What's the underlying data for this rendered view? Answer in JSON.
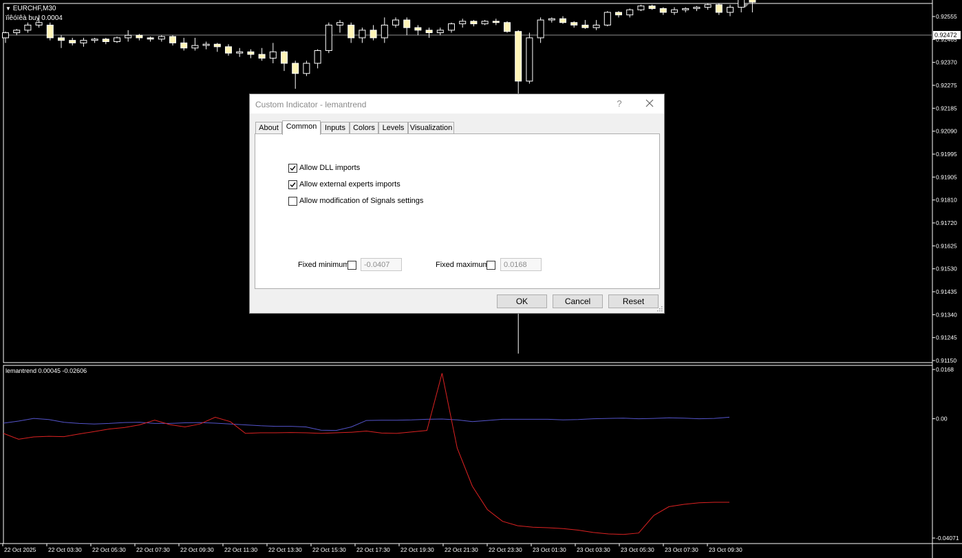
{
  "chart_header": {
    "symbol": "EURCHF,M30",
    "trade_label": "ïîêóïêà buy 0.0004"
  },
  "indicator_header": "lemantrend 0.00045 -0.02606",
  "colors": {
    "background": "#000000",
    "candle": "#FFFFFF",
    "bull_body": "#FFFFFF",
    "bear_body": "#FFF5B8",
    "line_blue": "#5555CC",
    "line_red": "#DD2222",
    "current_price_line": "#909090"
  },
  "price_axis": {
    "ticks": [
      "0.92555",
      "0.92465",
      "0.92370",
      "0.92275",
      "0.92185",
      "0.92090",
      "0.91995",
      "0.91905",
      "0.91810",
      "0.91720",
      "0.91625",
      "0.91530",
      "0.91435",
      "0.91340",
      "0.91245",
      "0.91150"
    ],
    "current_price": "0.92472",
    "covered_label": "0.92465"
  },
  "indicator_axis": {
    "ticks": [
      "0.0168",
      "0.00",
      "-0.04071"
    ]
  },
  "time_axis": {
    "ticks": [
      "22 Oct 2025",
      "22 Oct 03:30",
      "22 Oct 05:30",
      "22 Oct 07:30",
      "22 Oct 09:30",
      "22 Oct 11:30",
      "22 Oct 13:30",
      "22 Oct 15:30",
      "22 Oct 17:30",
      "22 Oct 19:30",
      "22 Oct 21:30",
      "22 Oct 23:30",
      "23 Oct 01:30",
      "23 Oct 03:30",
      "23 Oct 05:30",
      "23 Oct 07:30",
      "23 Oct 09:30"
    ]
  },
  "chart_data": [
    {
      "type": "candlestick",
      "title": "EURCHF,M30",
      "ylim": [
        0.9115,
        0.92555
      ],
      "candles": [
        [
          0.9242,
          0.9244,
          0.924,
          0.92445
        ],
        [
          0.9244,
          0.9245,
          0.9243,
          0.92455
        ],
        [
          0.9245,
          0.9247,
          0.9244,
          0.9248
        ],
        [
          0.9247,
          0.9248,
          0.9246,
          0.9251
        ],
        [
          0.9247,
          0.9242,
          0.9241,
          0.9248
        ],
        [
          0.9242,
          0.9241,
          0.9238,
          0.9243
        ],
        [
          0.9241,
          0.924,
          0.9239,
          0.9242
        ],
        [
          0.924,
          0.9241,
          0.92385,
          0.9242
        ],
        [
          0.9241,
          0.92415,
          0.924,
          0.9242
        ],
        [
          0.92415,
          0.92405,
          0.92395,
          0.9242
        ],
        [
          0.92405,
          0.9242,
          0.924,
          0.92425
        ],
        [
          0.9242,
          0.9243,
          0.92405,
          0.9245
        ],
        [
          0.9243,
          0.9242,
          0.9241,
          0.92435
        ],
        [
          0.9242,
          0.92415,
          0.92405,
          0.92425
        ],
        [
          0.92415,
          0.92425,
          0.92405,
          0.9243
        ],
        [
          0.92425,
          0.924,
          0.9239,
          0.9243
        ],
        [
          0.924,
          0.9238,
          0.9237,
          0.9242
        ],
        [
          0.9238,
          0.9239,
          0.9237,
          0.9242
        ],
        [
          0.9239,
          0.92395,
          0.92375,
          0.92405
        ],
        [
          0.92395,
          0.92385,
          0.92365,
          0.924
        ],
        [
          0.92385,
          0.9236,
          0.9235,
          0.92395
        ],
        [
          0.9236,
          0.92365,
          0.92345,
          0.9238
        ],
        [
          0.92365,
          0.92355,
          0.9234,
          0.92375
        ],
        [
          0.92355,
          0.9234,
          0.9233,
          0.9238
        ],
        [
          0.9234,
          0.92365,
          0.9232,
          0.924
        ],
        [
          0.92365,
          0.9232,
          0.9229,
          0.9237
        ],
        [
          0.9232,
          0.9228,
          0.9222,
          0.9233
        ],
        [
          0.9228,
          0.9232,
          0.9227,
          0.9233
        ],
        [
          0.9232,
          0.9237,
          0.923,
          0.92375
        ],
        [
          0.9237,
          0.9247,
          0.9236,
          0.9248
        ],
        [
          0.9247,
          0.9248,
          0.9244,
          0.9249
        ],
        [
          0.9247,
          0.9242,
          0.924,
          0.9248
        ],
        [
          0.9242,
          0.9245,
          0.924,
          0.9246
        ],
        [
          0.9245,
          0.9242,
          0.9241,
          0.9247
        ],
        [
          0.9242,
          0.9247,
          0.924,
          0.925
        ],
        [
          0.9247,
          0.9249,
          0.9246,
          0.925
        ],
        [
          0.9249,
          0.9246,
          0.9243,
          0.925
        ],
        [
          0.9246,
          0.9245,
          0.9243,
          0.9247
        ],
        [
          0.9245,
          0.9244,
          0.9242,
          0.9246
        ],
        [
          0.9244,
          0.9245,
          0.9243,
          0.9246
        ],
        [
          0.9245,
          0.92475,
          0.9244,
          0.9248
        ],
        [
          0.92475,
          0.92485,
          0.9246,
          0.92495
        ],
        [
          0.92485,
          0.92475,
          0.92465,
          0.9249
        ],
        [
          0.92475,
          0.92485,
          0.9247,
          0.9249
        ],
        [
          0.92485,
          0.9248,
          0.9247,
          0.92495
        ],
        [
          0.9248,
          0.92445,
          0.9244,
          0.92485
        ],
        [
          0.92445,
          0.9225,
          0.9118,
          0.9245
        ],
        [
          0.9225,
          0.9242,
          0.9224,
          0.9244
        ],
        [
          0.9242,
          0.9249,
          0.924,
          0.925
        ],
        [
          0.9249,
          0.92495,
          0.9248,
          0.925
        ],
        [
          0.92495,
          0.9248,
          0.92475,
          0.92505
        ],
        [
          0.9248,
          0.9247,
          0.9246,
          0.92485
        ],
        [
          0.9247,
          0.9246,
          0.92455,
          0.9249
        ],
        [
          0.9246,
          0.9247,
          0.9245,
          0.9249
        ],
        [
          0.9247,
          0.9252,
          0.92465,
          0.92525
        ],
        [
          0.9252,
          0.9251,
          0.925,
          0.92525
        ],
        [
          0.9251,
          0.9253,
          0.925,
          0.92535
        ],
        [
          0.9253,
          0.92545,
          0.92525,
          0.9255
        ],
        [
          0.92545,
          0.92535,
          0.9253,
          0.9255
        ],
        [
          0.92535,
          0.9252,
          0.9251,
          0.9254
        ],
        [
          0.9252,
          0.9253,
          0.9251,
          0.9254
        ],
        [
          0.9253,
          0.92535,
          0.9252,
          0.9254
        ],
        [
          0.92535,
          0.9254,
          0.92525,
          0.92545
        ],
        [
          0.9254,
          0.9255,
          0.9253,
          0.92555
        ],
        [
          0.9255,
          0.9252,
          0.9251,
          0.92555
        ],
        [
          0.9252,
          0.9254,
          0.92505,
          0.9255
        ],
        [
          0.9254,
          0.926,
          0.9252,
          0.9261
        ],
        [
          0.926,
          0.9256,
          0.9252,
          0.9262
        ]
      ]
    },
    {
      "type": "line",
      "title": "lemantrend 0.00045 -0.02606",
      "ylim": [
        -0.04071,
        0.0168
      ],
      "series": [
        {
          "color": "#5555CC",
          "values": [
            -0.0015,
            -0.0008,
            0.0001,
            -0.0003,
            -0.0012,
            -0.0016,
            -0.0018,
            -0.0016,
            -0.0013,
            -0.0012,
            -0.0016,
            -0.0016,
            -0.0014,
            -0.0013,
            -0.0015,
            -0.0018,
            -0.0021,
            -0.0024,
            -0.0026,
            -0.0026,
            -0.0028,
            -0.0039,
            -0.004,
            -0.0028,
            -0.0006,
            -0.0005,
            -0.0005,
            -0.0004,
            -0.0002,
            -0.0001,
            -0.0004,
            -0.001,
            -0.0006,
            -0.0002,
            -0.0002,
            -0.0002,
            -0.0002,
            -0.0004,
            -0.0003,
            0.0,
            0.0001,
            0.0002,
            0.0,
            0.0001,
            0.0003,
            0.0002,
            0.0,
            0.0001,
            0.0005
          ]
        },
        {
          "color": "#DD2222",
          "values": [
            -0.005,
            -0.007,
            -0.0062,
            -0.006,
            -0.0061,
            -0.0052,
            -0.0044,
            -0.0035,
            -0.003,
            -0.0021,
            -0.0005,
            -0.002,
            -0.0028,
            -0.0018,
            0.0005,
            -0.001,
            -0.005,
            -0.0048,
            -0.0048,
            -0.0047,
            -0.0048,
            -0.005,
            -0.0048,
            -0.0046,
            -0.0042,
            -0.0049,
            -0.005,
            -0.0045,
            -0.004,
            0.0155,
            -0.01,
            -0.023,
            -0.031,
            -0.035,
            -0.0365,
            -0.037,
            -0.0372,
            -0.0375,
            -0.038,
            -0.0388,
            -0.0393,
            -0.0395,
            -0.039,
            -0.033,
            -0.03,
            -0.0292,
            -0.0287,
            -0.0285,
            -0.0285
          ]
        }
      ]
    }
  ],
  "dialog": {
    "title": "Custom Indicator - lemantrend",
    "help_label": "?",
    "tabs": [
      {
        "label": "About"
      },
      {
        "label": "Common"
      },
      {
        "label": "Inputs"
      },
      {
        "label": "Colors"
      },
      {
        "label": "Levels"
      },
      {
        "label": "Visualization"
      }
    ],
    "active_tab": "Common",
    "options": {
      "allow_dll": {
        "label": "Allow DLL imports",
        "checked": true
      },
      "allow_external": {
        "label": "Allow external experts imports",
        "checked": true
      },
      "allow_signals": {
        "label": "Allow modification of Signals settings",
        "checked": false
      }
    },
    "fixed_minimum": {
      "label": "Fixed minimum",
      "checked": false,
      "value": "-0.0407"
    },
    "fixed_maximum": {
      "label": "Fixed maximum",
      "checked": false,
      "value": "0.0168"
    },
    "buttons": {
      "ok": "OK",
      "cancel": "Cancel",
      "reset": "Reset"
    }
  }
}
